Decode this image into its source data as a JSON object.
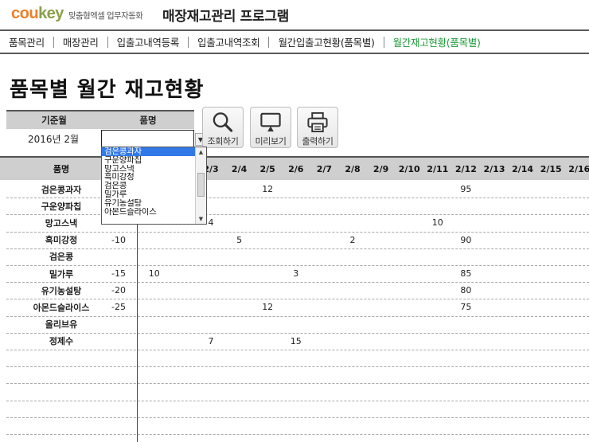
{
  "brand": {
    "logo_prefix": "cou",
    "logo_suffix": "key",
    "tagline": "맞춤형엑셀 업무자동화"
  },
  "app_title": "매장재고관리 프로그램",
  "nav": [
    {
      "label": "품목관리",
      "active": false
    },
    {
      "label": "매장관리",
      "active": false
    },
    {
      "label": "입출고내역등록",
      "active": false
    },
    {
      "label": "입출고내역조회",
      "active": false
    },
    {
      "label": "월간입출고현황(품목별)",
      "active": false
    },
    {
      "label": "월간재고현황(품목별)",
      "active": true
    }
  ],
  "page_title": "품목별 월간 재고현황",
  "filter": {
    "month_header": "기준월",
    "item_header": "품명",
    "month_value": "2016년 2월",
    "item_value": ""
  },
  "buttons": {
    "search": "조회하기",
    "preview": "미리보기",
    "print": "출력하기"
  },
  "grid": {
    "name_header": "품명",
    "date_headers": [
      "2/3",
      "2/4",
      "2/5",
      "2/6",
      "2/7",
      "2/8",
      "2/9",
      "2/10",
      "2/11",
      "2/12",
      "2/13",
      "2/14",
      "2/15",
      "2/16"
    ],
    "rows": [
      {
        "name": "검은콩과자",
        "stock": "",
        "values": {
          "2/5": "12",
          "2/12": "95"
        }
      },
      {
        "name": "구운양파칩",
        "stock": "",
        "values": {}
      },
      {
        "name": "망고스낵",
        "stock": "",
        "values": {
          "2/3": "4",
          "2/11": "10"
        }
      },
      {
        "name": "흑미강정",
        "stock": "-10",
        "values": {
          "2/4": "5",
          "2/8": "2",
          "2/12": "90"
        }
      },
      {
        "name": "검은콩",
        "stock": "",
        "values": {}
      },
      {
        "name": "밀가루",
        "stock": "-15",
        "values": {
          "2/1": "10",
          "2/6": "3",
          "2/12": "85"
        }
      },
      {
        "name": "유기농설탕",
        "stock": "-20",
        "values": {
          "2/12": "80"
        }
      },
      {
        "name": "아몬드슬라이스",
        "stock": "-25",
        "values": {
          "2/5": "12",
          "2/12": "75"
        }
      },
      {
        "name": "올리브유",
        "stock": "",
        "values": {}
      },
      {
        "name": "정제수",
        "stock": "",
        "values": {
          "2/3": "7",
          "2/6": "15"
        }
      }
    ]
  },
  "dropdown": {
    "options": [
      "검은콩과자",
      "구운양파칩",
      "망고스낵",
      "흑미강정",
      "검은콩",
      "밀가루",
      "유기농설탕",
      "아몬드슬라이스"
    ],
    "selected_index": 0
  },
  "colors": {
    "active_nav": "#1e9a3a",
    "logo_orange": "#f07f2a",
    "logo_green": "#8aa04a",
    "selection": "#3279e8",
    "header_bg": "#cfcfcf"
  }
}
